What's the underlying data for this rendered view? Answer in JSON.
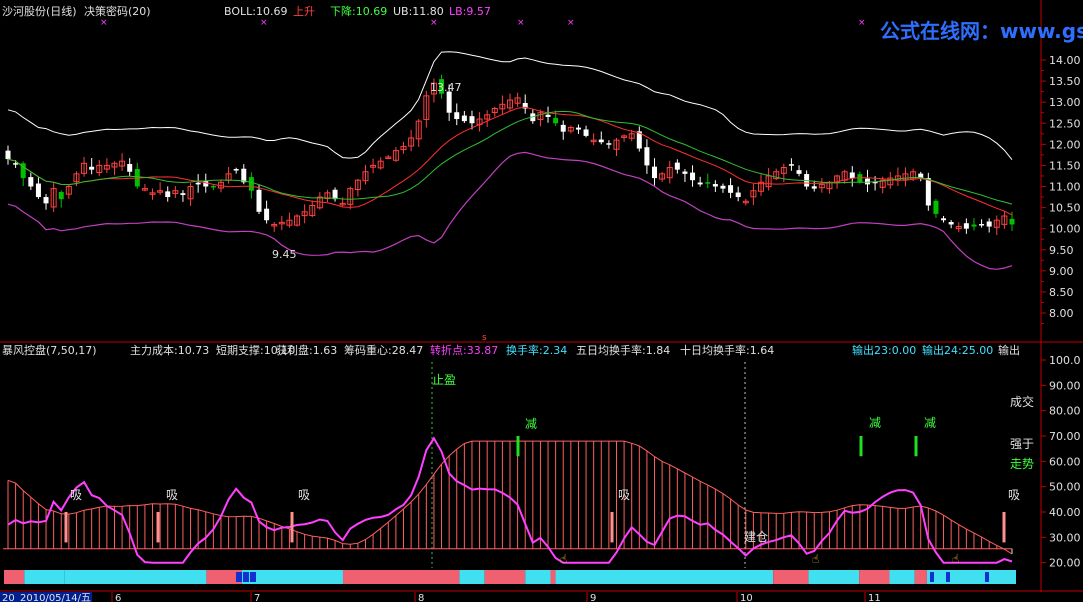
{
  "title_bar": {
    "stock": "沙河股份(日线)",
    "formula": "决策密码(20)",
    "boll_label": "BOLL:10.69",
    "upper_label": "上升",
    "lower_label": "下降:10.69",
    "ub_label": "UB:11.80",
    "lb_label": "LB:9.57"
  },
  "watermark": "公式在线网：www.gszx.com.cn",
  "indicator_bar": {
    "items": [
      "暴风控盘(7,50,17)",
      "主力成本:10.73",
      "短期支撑:10.10",
      "获利盘:1.63",
      "筹码重心:28.47",
      "转折点:33.87",
      "换手率:2.34",
      "五日均换手率:1.84",
      "十日均换手率:1.64",
      "输出23:0.00",
      "输出24:25.00",
      "输出"
    ]
  },
  "price_axis": {
    "ticks": [
      "14.00",
      "13.50",
      "13.00",
      "12.50",
      "12.00",
      "11.50",
      "11.00",
      "10.50",
      "10.00",
      "9.50",
      "9.00",
      "8.50",
      "8.00"
    ]
  },
  "ind_axis": {
    "ticks": [
      "100.0",
      "90.00",
      "80.00",
      "70.00",
      "60.00",
      "50.00",
      "40.00",
      "30.00",
      "20.00"
    ]
  },
  "annotations": {
    "high": "13.47",
    "low": "9.45",
    "zhiying": "止盈",
    "jian": "减",
    "xi": "吸",
    "jiancang": "建仓",
    "chengjiao": "成交",
    "qiangyu": "强于",
    "zoushi": "走势",
    "s_marker": "s"
  },
  "date_axis": {
    "start": "2010/05/14/五",
    "prefix": "20",
    "months": [
      "6",
      "7",
      "8",
      "9",
      "10",
      "11"
    ]
  },
  "colors": {
    "up": "#ff4040",
    "down": "#ffffff",
    "green": "#00c000",
    "boll_upper": "#ffffff",
    "boll_mid": "#ff3030",
    "boll_lower": "#c040c0",
    "magenta": "#ff40ff",
    "cyan": "#40e0ff",
    "pink": "#ff6060",
    "axis": "#c00000"
  },
  "chart_data": {
    "type": "candlestick",
    "ylim": [
      7.8,
      14.2
    ],
    "closes": [
      11.65,
      11.55,
      11.2,
      11.0,
      10.75,
      10.6,
      10.95,
      10.7,
      11.0,
      11.3,
      11.55,
      11.4,
      11.5,
      11.5,
      11.55,
      11.6,
      11.35,
      11.0,
      10.95,
      10.85,
      10.9,
      10.75,
      10.9,
      10.8,
      11.0,
      11.05,
      11.0,
      11.0,
      11.1,
      11.3,
      11.4,
      11.1,
      10.9,
      10.4,
      10.2,
      10.1,
      10.15,
      10.2,
      10.3,
      10.4,
      10.55,
      10.75,
      10.85,
      10.7,
      10.6,
      10.95,
      11.15,
      11.35,
      11.5,
      11.6,
      11.7,
      11.85,
      11.95,
      12.15,
      12.55,
      13.15,
      13.45,
      13.2,
      12.75,
      12.6,
      12.55,
      12.5,
      12.6,
      12.7,
      12.85,
      12.95,
      13.05,
      13.1,
      12.85,
      12.55,
      12.75,
      12.65,
      12.5,
      12.3,
      12.4,
      12.35,
      12.2,
      12.1,
      12.05,
      12.0,
      12.1,
      12.2,
      12.25,
      11.9,
      11.5,
      11.2,
      11.3,
      11.45,
      11.4,
      11.3,
      11.15,
      11.05,
      11.1,
      11.0,
      10.95,
      10.85,
      10.75,
      10.65,
      10.9,
      11.1,
      11.25,
      11.35,
      11.45,
      11.5,
      11.3,
      11.0,
      10.95,
      11.05,
      11.1,
      11.25,
      11.35,
      11.2,
      11.1,
      11.05,
      11.1,
      11.15,
      11.2,
      11.25,
      11.3,
      11.35,
      11.2,
      10.55,
      10.35,
      10.2,
      10.1,
      10.05,
      10.0,
      10.05,
      10.1,
      10.05,
      10.2,
      10.3,
      10.1
    ]
  },
  "bottom_strip": [
    {
      "to": 0.02,
      "c": "pink"
    },
    {
      "to": 0.06,
      "c": "cyan"
    },
    {
      "to": 0.2,
      "c": "cyan"
    },
    {
      "to": 0.235,
      "c": "pink"
    },
    {
      "to": 0.335,
      "c": "cyan"
    },
    {
      "to": 0.45,
      "c": "pink"
    },
    {
      "to": 0.475,
      "c": "cyan"
    },
    {
      "to": 0.515,
      "c": "pink"
    },
    {
      "to": 0.54,
      "c": "cyan"
    },
    {
      "to": 0.545,
      "c": "pink"
    },
    {
      "to": 0.76,
      "c": "cyan"
    },
    {
      "to": 0.795,
      "c": "pink"
    },
    {
      "to": 0.845,
      "c": "cyan"
    },
    {
      "to": 0.875,
      "c": "pink"
    },
    {
      "to": 0.9,
      "c": "cyan"
    },
    {
      "to": 0.912,
      "c": "pink"
    },
    {
      "to": 1.0,
      "c": "cyan"
    }
  ]
}
